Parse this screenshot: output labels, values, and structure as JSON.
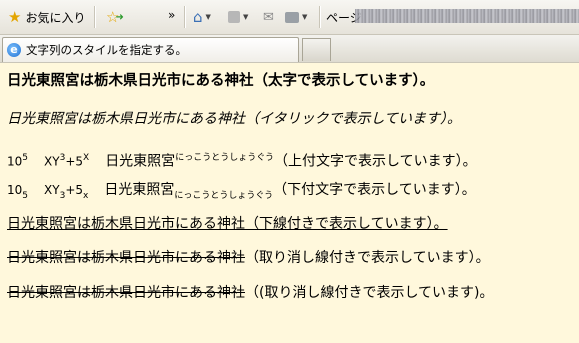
{
  "toolbar": {
    "favorites_label": "お気に入り",
    "overflow": "»",
    "page_label": "ページ"
  },
  "tab": {
    "title": "文字列のスタイルを指定する。"
  },
  "content": {
    "line1": "日光東照宮は栃木県日光市にある神社（太字で表示しています）。",
    "line2": "日光東照宮は栃木県日光市にある神社（イタリックで表示しています）。",
    "line3": {
      "base1": "10",
      "sup1": "5",
      "base2": "XY",
      "sup2": "3",
      "mid": "+5",
      "sup3": "X",
      "name": "日光東照宮",
      "ruby": "にっこうとうしょうぐう",
      "tail": "（上付文字で表示しています）。"
    },
    "line4": {
      "base1": "10",
      "sub1": "5",
      "base2": "XY",
      "sub2": "3",
      "mid": "+5",
      "sub3": "x",
      "name": "日光東照宮",
      "ruby": "にっこうとうしょうぐう",
      "tail": "（下付文字で表示しています）。"
    },
    "line5": "日光東照宮は栃木県日光市にある神社（下線付きで表示しています）。",
    "line6": "日光東照宮は栃木県日光市にある神社（取り消し線付きで表示しています）。",
    "line7_struck": "日光東照宮は栃木県日光市にある神社",
    "line7_tail": "（(取り消し線付きで表示しています)。"
  }
}
